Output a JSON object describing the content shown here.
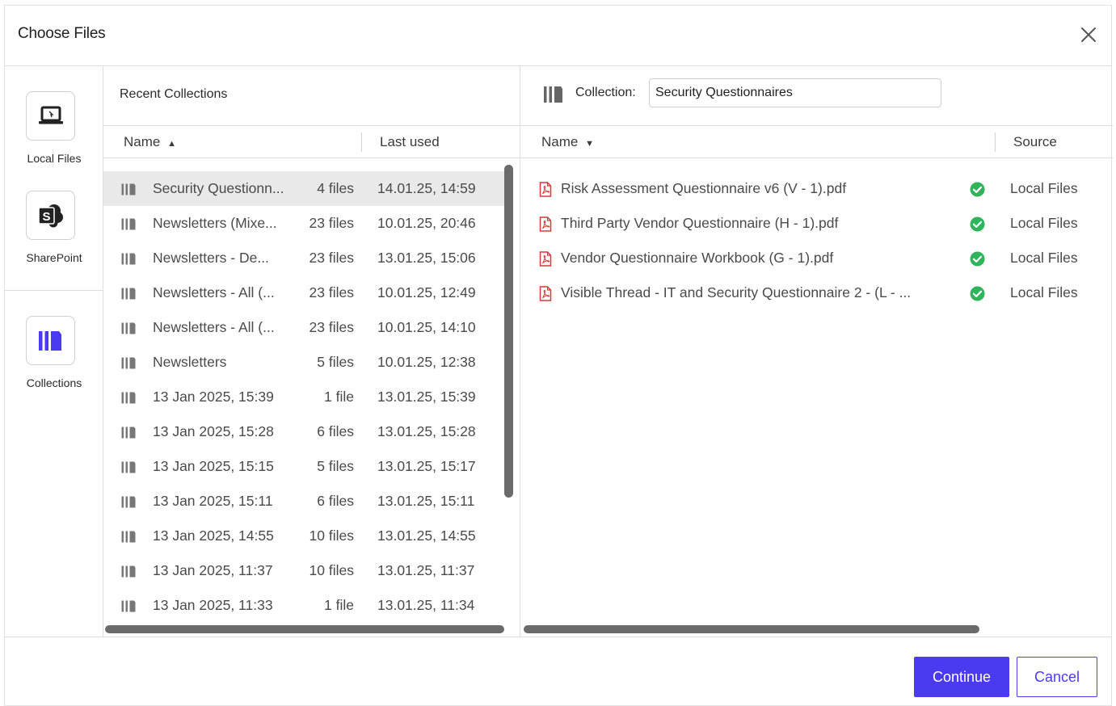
{
  "dialog": {
    "title": "Choose Files",
    "close_icon": "close-icon"
  },
  "sidebar": {
    "items": [
      {
        "label": "Local Files",
        "icon": "laptop-icon"
      },
      {
        "label": "SharePoint",
        "icon": "sharepoint-icon"
      },
      {
        "label": "Collections",
        "icon": "collections-icon"
      }
    ],
    "active_color": "#4a3af0"
  },
  "recent": {
    "title": "Recent Collections",
    "columns": {
      "name": "Name",
      "last_used": "Last used"
    },
    "sort_indicator": "▲",
    "rows": [
      {
        "name": "Security Questionn...",
        "count": "4 files",
        "last_used": "14.01.25, 14:59",
        "selected": true
      },
      {
        "name": "Newsletters (Mixe...",
        "count": "23 files",
        "last_used": "10.01.25, 20:46"
      },
      {
        "name": "Newsletters - De...",
        "count": "23 files",
        "last_used": "13.01.25, 15:06"
      },
      {
        "name": "Newsletters - All (...",
        "count": "23 files",
        "last_used": "10.01.25, 12:49"
      },
      {
        "name": "Newsletters - All (...",
        "count": "23 files",
        "last_used": "10.01.25, 14:10"
      },
      {
        "name": "Newsletters",
        "count": "5 files",
        "last_used": "10.01.25, 12:38"
      },
      {
        "name": "13 Jan 2025, 15:39",
        "count": "1 file",
        "last_used": "13.01.25, 15:39"
      },
      {
        "name": "13 Jan 2025, 15:28",
        "count": "6 files",
        "last_used": "13.01.25, 15:28"
      },
      {
        "name": "13 Jan 2025, 15:15",
        "count": "5 files",
        "last_used": "13.01.25, 15:17"
      },
      {
        "name": "13 Jan 2025, 15:11",
        "count": "6 files",
        "last_used": "13.01.25, 15:11"
      },
      {
        "name": "13 Jan 2025, 14:55",
        "count": "10 files",
        "last_used": "13.01.25, 14:55"
      },
      {
        "name": "13 Jan 2025, 11:37",
        "count": "10 files",
        "last_used": "13.01.25, 11:37"
      },
      {
        "name": "13 Jan 2025, 11:33",
        "count": "1 file",
        "last_used": "13.01.25, 11:34"
      }
    ]
  },
  "collection": {
    "label": "Collection:",
    "value": "Security Questionnaires",
    "columns": {
      "name": "Name",
      "source": "Source"
    },
    "sort_indicator": "▼",
    "files": [
      {
        "name": "Risk Assessment Questionnaire v6 (V - 1).pdf",
        "source": "Local Files",
        "status": "check-icon"
      },
      {
        "name": "Third Party Vendor Questionnaire (H - 1).pdf",
        "source": "Local Files",
        "status": "check-icon"
      },
      {
        "name": "Vendor Questionnaire Workbook (G - 1).pdf",
        "source": "Local Files",
        "status": "check-icon"
      },
      {
        "name": "Visible Thread - IT and Security Questionnaire 2 - (L - ...",
        "source": "Local Files",
        "status": "check-icon"
      }
    ]
  },
  "footer": {
    "continue_label": "Continue",
    "cancel_label": "Cancel"
  },
  "colors": {
    "accent": "#4a3af0",
    "success": "#2fb35b",
    "pdf": "#d9383a"
  }
}
